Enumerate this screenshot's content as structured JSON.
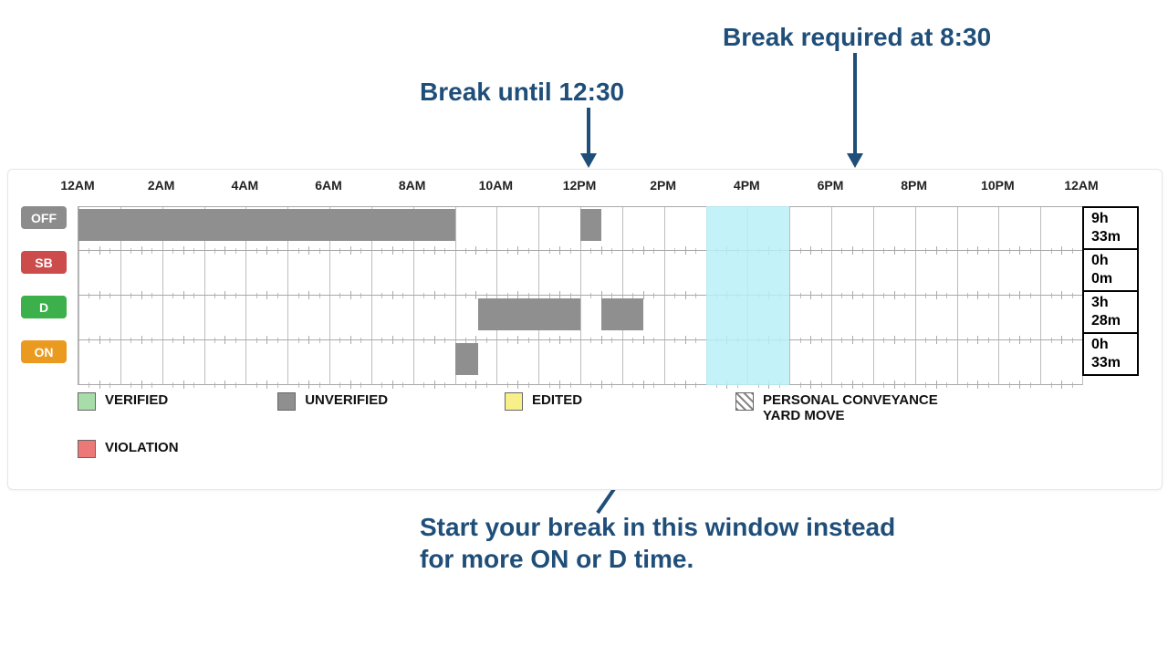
{
  "annotations": {
    "top1": "Break until 12:30",
    "top2": "Break required at 8:30",
    "bottom": "Start your break in this window instead\nfor more ON or D time."
  },
  "hours": [
    "12AM",
    "2AM",
    "4AM",
    "6AM",
    "8AM",
    "10AM",
    "12PM",
    "2PM",
    "4PM",
    "6PM",
    "8PM",
    "10PM",
    "12AM"
  ],
  "rows": [
    {
      "key": "OFF",
      "color": "off"
    },
    {
      "key": "SB",
      "color": "sb"
    },
    {
      "key": "D",
      "color": "d"
    },
    {
      "key": "ON",
      "color": "on"
    }
  ],
  "totals": {
    "OFF": {
      "h": "9h",
      "m": "33m"
    },
    "SB": {
      "h": "0h",
      "m": "0m"
    },
    "D": {
      "h": "3h",
      "m": "28m"
    },
    "ON": {
      "h": "0h",
      "m": "33m"
    }
  },
  "legend": {
    "verified": "VERIFIED",
    "unverified": "UNVERIFIED",
    "edited": "EDITED",
    "pc": "PERSONAL CONVEYANCE\nYARD MOVE",
    "violation": "VIOLATION"
  },
  "chart_data": {
    "type": "timeline",
    "xunit": "hours_from_midnight",
    "xrange": [
      0,
      24
    ],
    "rows": [
      "OFF",
      "SB",
      "D",
      "ON"
    ],
    "segments": [
      {
        "row": "OFF",
        "start": 0.0,
        "end": 9.0,
        "status": "unverified"
      },
      {
        "row": "ON",
        "start": 9.0,
        "end": 9.55,
        "status": "unverified"
      },
      {
        "row": "D",
        "start": 9.55,
        "end": 12.0,
        "status": "unverified"
      },
      {
        "row": "OFF",
        "start": 12.0,
        "end": 12.5,
        "status": "unverified"
      },
      {
        "row": "D",
        "start": 12.5,
        "end": 13.5,
        "status": "unverified"
      }
    ],
    "highlight_window": {
      "start": 15.0,
      "end": 17.0
    },
    "totals": {
      "OFF": {
        "h": 9,
        "m": 33
      },
      "SB": {
        "h": 0,
        "m": 0
      },
      "D": {
        "h": 3,
        "m": 28
      },
      "ON": {
        "h": 0,
        "m": 33
      }
    },
    "annotations": [
      {
        "text": "Break until 12:30",
        "points_to_hour": 12.5
      },
      {
        "text": "Break required at 8:30",
        "points_to_hour": 20.5
      },
      {
        "text": "Start your break in this window instead for more ON or D time.",
        "points_to_hour": 15.0
      }
    ]
  }
}
